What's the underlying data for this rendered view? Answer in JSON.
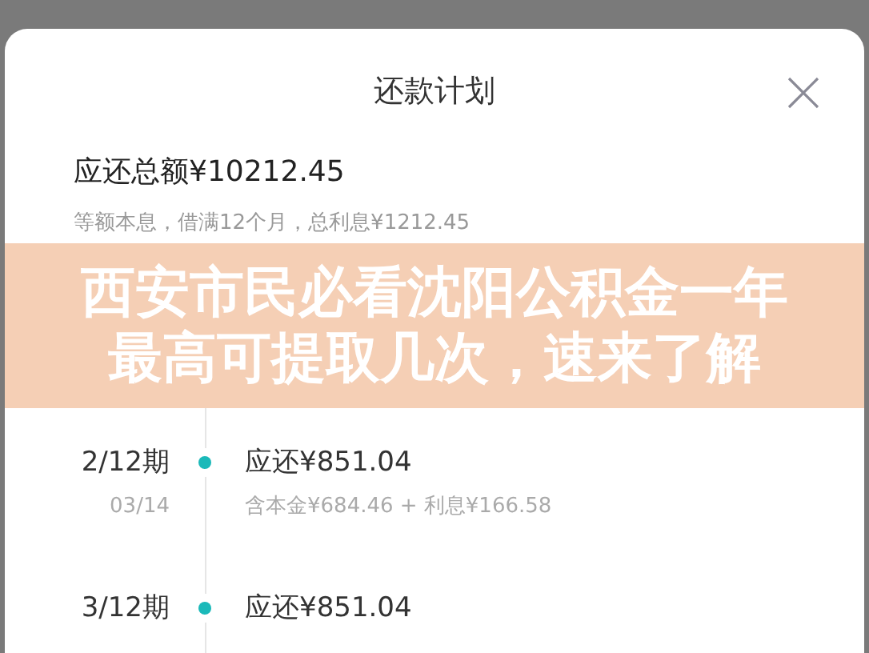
{
  "sheet": {
    "title": "还款计划",
    "total": "应还总额¥10212.45",
    "summary": "等额本息，借满12个月，总利息¥1212.45"
  },
  "overlay_banner": {
    "text": "西安市民必看沈阳公积金一年最高可提取几次，速来了解"
  },
  "installments": [
    {
      "period": "2/12期",
      "date": "03/14",
      "amount": "应还¥851.04",
      "breakdown": "含本金¥684.46 + 利息¥166.58"
    },
    {
      "period": "3/12期",
      "amount": "应还¥851.04"
    }
  ]
}
